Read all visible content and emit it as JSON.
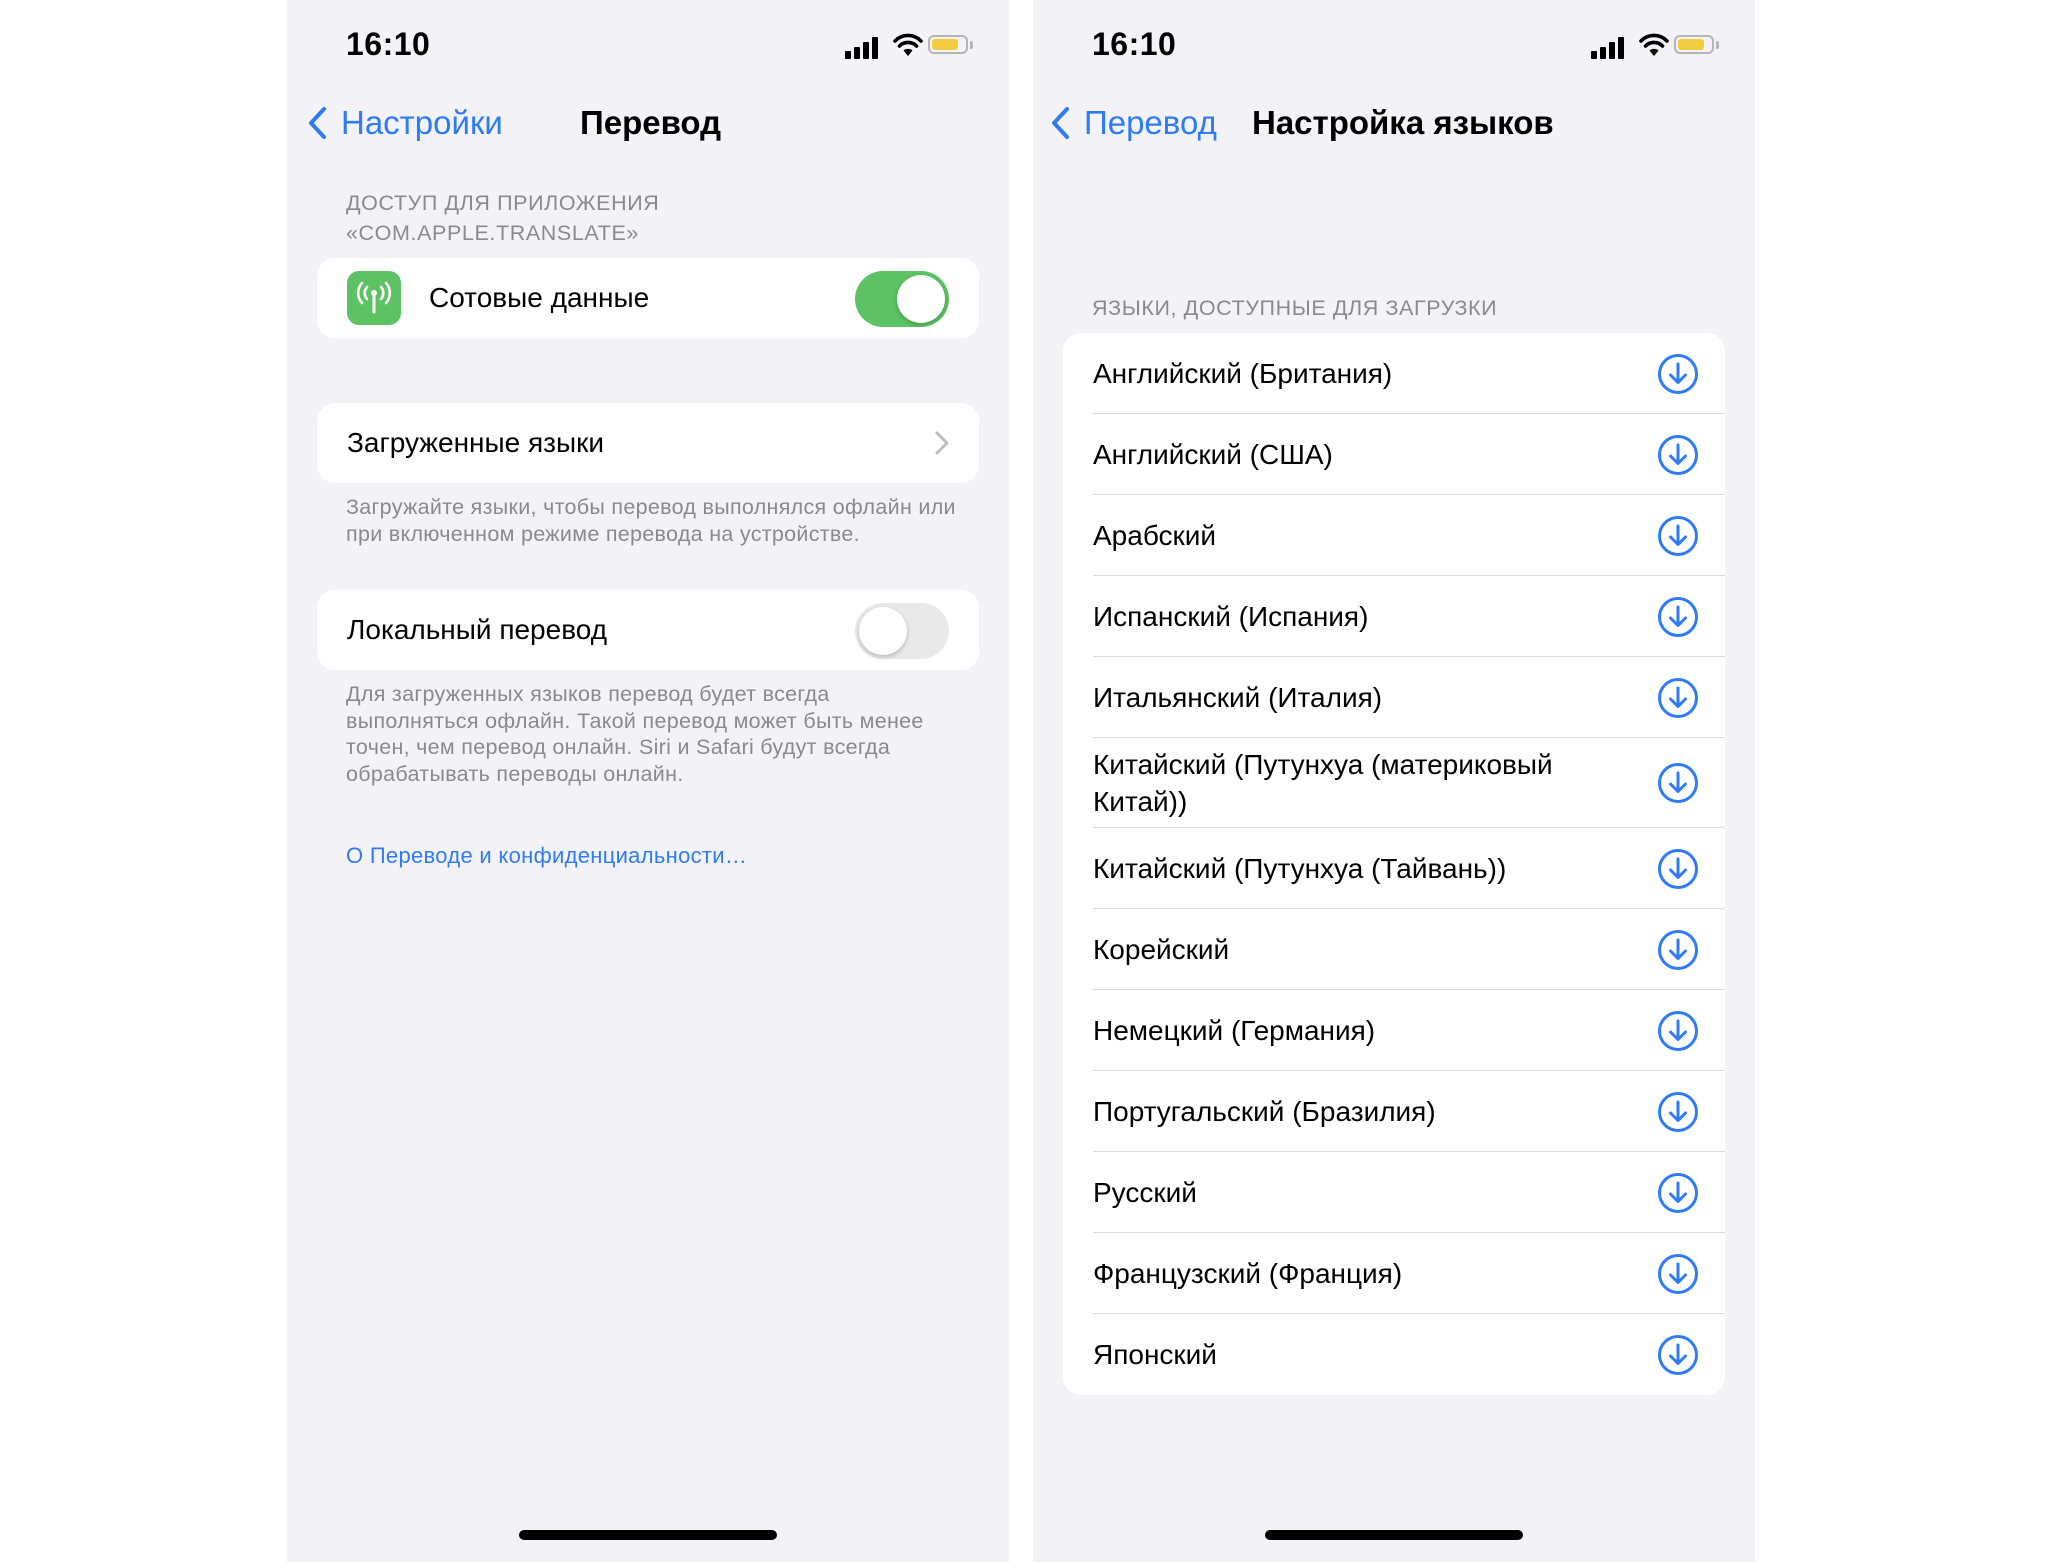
{
  "status_bar": {
    "time": "16:10"
  },
  "left_screen": {
    "back_label": "Настройки",
    "title": "Перевод",
    "access_header_line1": "ДОСТУП ДЛЯ ПРИЛОЖЕНИЯ",
    "access_header_line2": "«COM.APPLE.TRANSLATE»",
    "cellular": {
      "label": "Сотовые данные",
      "enabled": true
    },
    "downloaded_languages_label": "Загруженные языки",
    "downloaded_footer": "Загружайте языки, чтобы перевод выполнялся офлайн или при включенном режиме перевода на устройстве.",
    "on_device": {
      "label": "Локальный перевод",
      "enabled": false
    },
    "on_device_footer": "Для загруженных языков перевод будет всегда выполняться офлайн. Такой перевод может быть менее точен, чем перевод онлайн. Siri и Safari будут всегда обрабатывать переводы онлайн.",
    "privacy_link": "О Переводе и конфиденциальности…"
  },
  "right_screen": {
    "back_label": "Перевод",
    "title": "Настройка языков",
    "section_header": "ЯЗЫКИ, ДОСТУПНЫЕ ДЛЯ ЗАГРУЗКИ",
    "languages": [
      "Английский (Британия)",
      "Английский (США)",
      "Арабский",
      "Испанский (Испания)",
      "Итальянский (Италия)",
      "Китайский (Путунхуа (материковый Китай))",
      "Китайский (Путунхуа (Тайвань))",
      "Корейский",
      "Немецкий (Германия)",
      "Португальский (Бразилия)",
      "Русский",
      "Французский (Франция)",
      "Японский"
    ]
  },
  "colors": {
    "accent": "#2f7bf5",
    "toggle_on": "#5cc264",
    "background": "#f2f2f7",
    "secondary_text": "#8a8a8e",
    "battery": "#f2cc3f"
  },
  "icons": {
    "back": "chevron-left-icon",
    "cellular": "antenna-icon",
    "disclosure": "chevron-right-icon",
    "download": "download-circle-icon"
  }
}
